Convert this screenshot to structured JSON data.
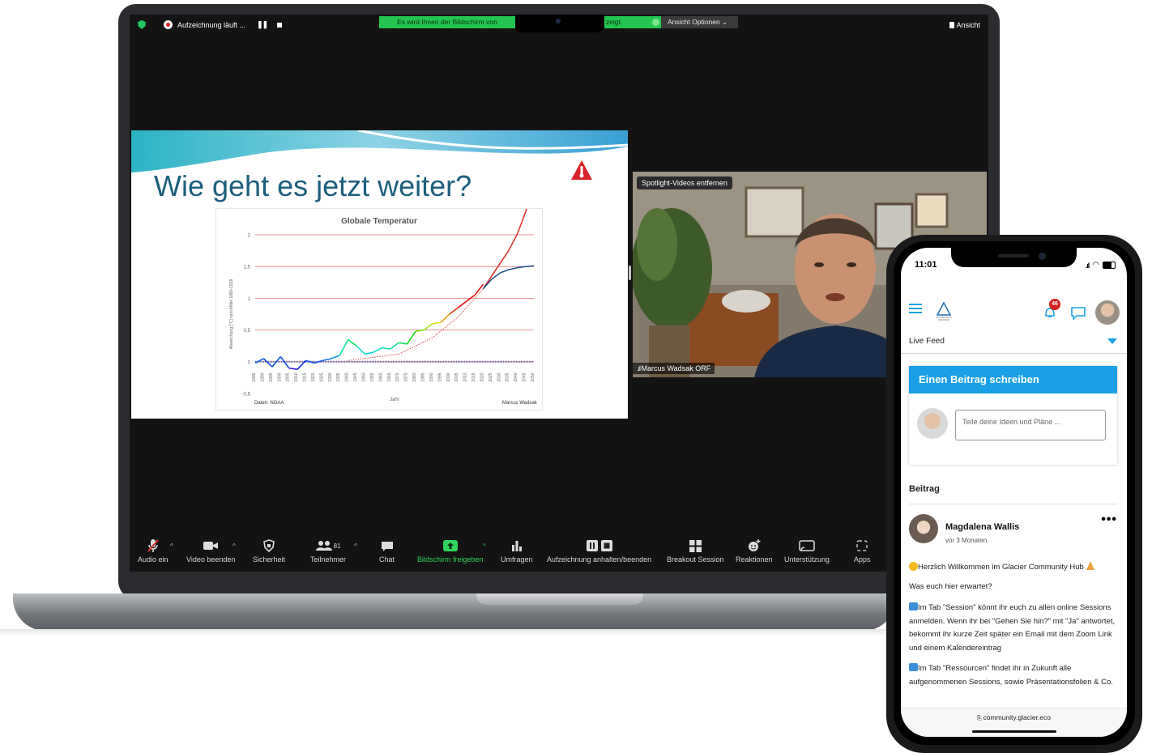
{
  "zoom": {
    "top": {
      "recording": "Aufzeichnung läuft ...",
      "share_notice_left": "Es wird Ihnen der Bildschirm von",
      "share_notice_right": "zeigt.",
      "view_options": "Ansicht Optionen ⌄",
      "view": "Ansicht"
    },
    "slide": {
      "title": "Wie geht es jetzt weiter?",
      "source": "Daten: NOAA",
      "author": "Marcus Wadsak",
      "x_tick_labels": [
        "1885",
        "1890",
        "1895",
        "1900",
        "1905",
        "1910",
        "1915",
        "1920",
        "1925",
        "1930",
        "1935",
        "1940",
        "1945",
        "1950",
        "1955",
        "1960",
        "1965",
        "1970",
        "1975",
        "1980",
        "1985",
        "1990",
        "1995",
        "2000",
        "2005",
        "2010",
        "2015",
        "2020",
        "2025",
        "2030",
        "2035",
        "2040",
        "2045",
        "2050"
      ]
    },
    "video": {
      "spotlight_button": "Spotlight-Videos entfernen",
      "participant_name": "Marcus Wadsak ORF"
    },
    "toolbar": {
      "audio": "Audio ein",
      "video": "Video beenden",
      "security": "Sicherheit",
      "participants": "Teilnehmer",
      "participants_count": "81",
      "chat": "Chat",
      "share": "Bildschirm freigeben",
      "polls": "Umfragen",
      "record": "Aufzeichnung anhalten/beenden",
      "breakout": "Breakout Session",
      "reactions": "Reaktionen",
      "support": "Unterstützung",
      "apps": "Apps"
    }
  },
  "chart_data": {
    "type": "line",
    "title": "Globale Temperatur",
    "xlabel": "Jahr",
    "ylabel": "Abweichung [°C] vom Mittel 1880-1918",
    "ylim": [
      -0.5,
      2
    ],
    "yticks": [
      "2",
      "1,5",
      "1",
      "0,5",
      "0",
      "-0,5"
    ],
    "grid": true,
    "series": [
      {
        "x": [
          1885,
          1890,
          1895,
          1900,
          1905,
          1910,
          1915,
          1920,
          1925,
          1930,
          1935,
          1940,
          1945,
          1950,
          1955,
          1960,
          1965,
          1970,
          1975,
          1980,
          1985,
          1990,
          1995,
          2000,
          2005,
          2010,
          2015,
          2020
        ],
        "values": [
          -0.02,
          0.05,
          -0.08,
          0.08,
          -0.1,
          -0.12,
          0.02,
          -0.02,
          0.02,
          0.05,
          0.1,
          0.35,
          0.25,
          0.12,
          0.15,
          0.22,
          0.2,
          0.3,
          0.28,
          0.48,
          0.5,
          0.6,
          0.62,
          0.75,
          0.85,
          0.95,
          1.05,
          1.22
        ]
      },
      {
        "x": [
          2020,
          2025,
          2030,
          2035,
          2040,
          2045,
          2050
        ],
        "values": [
          1.15,
          1.35,
          1.55,
          1.75,
          2.0,
          2.35,
          2.8
        ]
      },
      {
        "x": [
          2020,
          2025,
          2030,
          2035,
          2040,
          2045,
          2050
        ],
        "values": [
          1.15,
          1.3,
          1.4,
          1.45,
          1.48,
          1.5,
          1.51
        ]
      }
    ]
  },
  "community": {
    "time": "11:01",
    "notification_count": "46",
    "feed_label": "Live Feed",
    "write_header": "Einen Beitrag schreiben",
    "write_placeholder": "Teile deine Ideen und Pläne ...",
    "post_section": "Beitrag",
    "post_author": "Magdalena Wallis",
    "post_time": "vor 3 Monaten",
    "post_line1": "Herzlich Willkommen im Glacier Community Hub",
    "post_line2": "Was euch hier erwartet?",
    "post_para1": "Im Tab \"Session\" könnt ihr euch zu allen online Sessions anmelden. Wenn ihr bei \"Gehen Sie hin?\" mit \"Ja\" antwortet, bekommt ihr kurze Zeit später ein Email mit dem Zoom Link und einem Kalendereintrag",
    "post_para2": "Im Tab \"Ressourcen\" findet ihr in Zukunft alle aufgenommenen Sessions, sowie Präsentationsfolien & Co.",
    "url": "community.glacier.eco"
  },
  "colors": {
    "zoom_green": "#23c550",
    "accent_blue": "#1aa0e6",
    "title_teal": "#1d5f7d"
  }
}
